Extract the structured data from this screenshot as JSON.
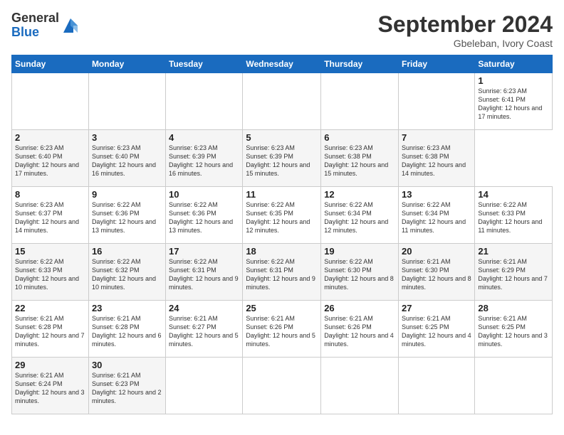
{
  "header": {
    "logo_line1": "General",
    "logo_line2": "Blue",
    "month_title": "September 2024",
    "location": "Gbeleban, Ivory Coast"
  },
  "calendar": {
    "days_of_week": [
      "Sunday",
      "Monday",
      "Tuesday",
      "Wednesday",
      "Thursday",
      "Friday",
      "Saturday"
    ],
    "weeks": [
      [
        null,
        null,
        null,
        null,
        null,
        null,
        {
          "day": "1",
          "sunrise": "6:23 AM",
          "sunset": "6:41 PM",
          "daylight": "12 hours and 17 minutes."
        }
      ],
      [
        {
          "day": "2",
          "sunrise": "6:23 AM",
          "sunset": "6:40 PM",
          "daylight": "12 hours and 17 minutes."
        },
        {
          "day": "3",
          "sunrise": "6:23 AM",
          "sunset": "6:40 PM",
          "daylight": "12 hours and 16 minutes."
        },
        {
          "day": "4",
          "sunrise": "6:23 AM",
          "sunset": "6:39 PM",
          "daylight": "12 hours and 16 minutes."
        },
        {
          "day": "5",
          "sunrise": "6:23 AM",
          "sunset": "6:39 PM",
          "daylight": "12 hours and 15 minutes."
        },
        {
          "day": "6",
          "sunrise": "6:23 AM",
          "sunset": "6:38 PM",
          "daylight": "12 hours and 15 minutes."
        },
        {
          "day": "7",
          "sunrise": "6:23 AM",
          "sunset": "6:38 PM",
          "daylight": "12 hours and 14 minutes."
        }
      ],
      [
        {
          "day": "8",
          "sunrise": "6:23 AM",
          "sunset": "6:37 PM",
          "daylight": "12 hours and 14 minutes."
        },
        {
          "day": "9",
          "sunrise": "6:22 AM",
          "sunset": "6:36 PM",
          "daylight": "12 hours and 13 minutes."
        },
        {
          "day": "10",
          "sunrise": "6:22 AM",
          "sunset": "6:36 PM",
          "daylight": "12 hours and 13 minutes."
        },
        {
          "day": "11",
          "sunrise": "6:22 AM",
          "sunset": "6:35 PM",
          "daylight": "12 hours and 12 minutes."
        },
        {
          "day": "12",
          "sunrise": "6:22 AM",
          "sunset": "6:34 PM",
          "daylight": "12 hours and 12 minutes."
        },
        {
          "day": "13",
          "sunrise": "6:22 AM",
          "sunset": "6:34 PM",
          "daylight": "12 hours and 11 minutes."
        },
        {
          "day": "14",
          "sunrise": "6:22 AM",
          "sunset": "6:33 PM",
          "daylight": "12 hours and 11 minutes."
        }
      ],
      [
        {
          "day": "15",
          "sunrise": "6:22 AM",
          "sunset": "6:33 PM",
          "daylight": "12 hours and 10 minutes."
        },
        {
          "day": "16",
          "sunrise": "6:22 AM",
          "sunset": "6:32 PM",
          "daylight": "12 hours and 10 minutes."
        },
        {
          "day": "17",
          "sunrise": "6:22 AM",
          "sunset": "6:31 PM",
          "daylight": "12 hours and 9 minutes."
        },
        {
          "day": "18",
          "sunrise": "6:22 AM",
          "sunset": "6:31 PM",
          "daylight": "12 hours and 9 minutes."
        },
        {
          "day": "19",
          "sunrise": "6:22 AM",
          "sunset": "6:30 PM",
          "daylight": "12 hours and 8 minutes."
        },
        {
          "day": "20",
          "sunrise": "6:21 AM",
          "sunset": "6:30 PM",
          "daylight": "12 hours and 8 minutes."
        },
        {
          "day": "21",
          "sunrise": "6:21 AM",
          "sunset": "6:29 PM",
          "daylight": "12 hours and 7 minutes."
        }
      ],
      [
        {
          "day": "22",
          "sunrise": "6:21 AM",
          "sunset": "6:28 PM",
          "daylight": "12 hours and 7 minutes."
        },
        {
          "day": "23",
          "sunrise": "6:21 AM",
          "sunset": "6:28 PM",
          "daylight": "12 hours and 6 minutes."
        },
        {
          "day": "24",
          "sunrise": "6:21 AM",
          "sunset": "6:27 PM",
          "daylight": "12 hours and 5 minutes."
        },
        {
          "day": "25",
          "sunrise": "6:21 AM",
          "sunset": "6:26 PM",
          "daylight": "12 hours and 5 minutes."
        },
        {
          "day": "26",
          "sunrise": "6:21 AM",
          "sunset": "6:26 PM",
          "daylight": "12 hours and 4 minutes."
        },
        {
          "day": "27",
          "sunrise": "6:21 AM",
          "sunset": "6:25 PM",
          "daylight": "12 hours and 4 minutes."
        },
        {
          "day": "28",
          "sunrise": "6:21 AM",
          "sunset": "6:25 PM",
          "daylight": "12 hours and 3 minutes."
        }
      ],
      [
        {
          "day": "29",
          "sunrise": "6:21 AM",
          "sunset": "6:24 PM",
          "daylight": "12 hours and 3 minutes."
        },
        {
          "day": "30",
          "sunrise": "6:21 AM",
          "sunset": "6:23 PM",
          "daylight": "12 hours and 2 minutes."
        },
        null,
        null,
        null,
        null,
        null
      ]
    ]
  }
}
